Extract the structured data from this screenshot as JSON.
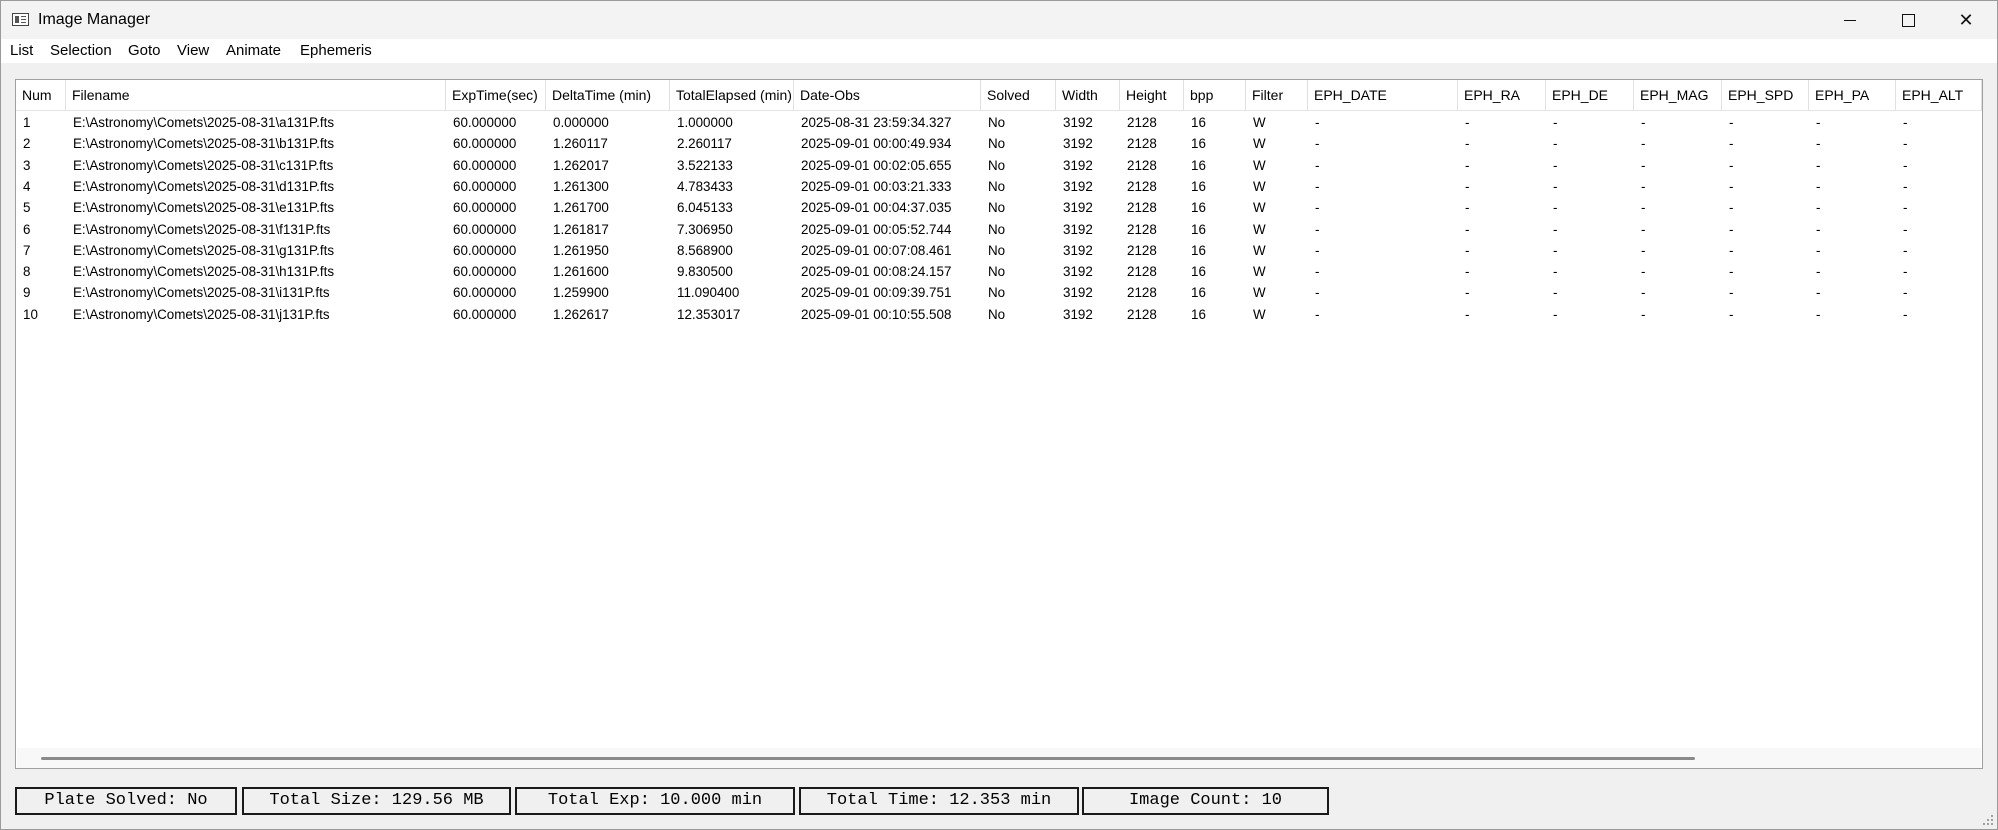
{
  "window": {
    "title": "Image Manager"
  },
  "menu": [
    {
      "label": "List",
      "name": "menu-list"
    },
    {
      "label": "Selection",
      "name": "menu-selection"
    },
    {
      "label": "Goto",
      "name": "menu-goto"
    },
    {
      "label": "View",
      "name": "menu-view"
    },
    {
      "label": "Animate",
      "name": "menu-animate"
    },
    {
      "label": "Ephemeris",
      "name": "menu-ephemeris"
    }
  ],
  "table": {
    "columns": [
      "Num",
      "Filename",
      "ExpTime(sec)",
      "DeltaTime (min)",
      "TotalElapsed (min)",
      "Date-Obs",
      "Solved",
      "Width",
      "Height",
      "bpp",
      "Filter",
      "EPH_DATE",
      "EPH_RA",
      "EPH_DE",
      "EPH_MAG",
      "EPH_SPD",
      "EPH_PA",
      "EPH_ALT"
    ],
    "rows": [
      [
        "1",
        "E:\\Astronomy\\Comets\\2025-08-31\\a131P.fts",
        "60.000000",
        "0.000000",
        "1.000000",
        "2025-08-31 23:59:34.327",
        "No",
        "3192",
        "2128",
        "16",
        "W",
        "-",
        "-",
        "-",
        "-",
        "-",
        "-",
        "-"
      ],
      [
        "2",
        "E:\\Astronomy\\Comets\\2025-08-31\\b131P.fts",
        "60.000000",
        "1.260117",
        "2.260117",
        "2025-09-01 00:00:49.934",
        "No",
        "3192",
        "2128",
        "16",
        "W",
        "-",
        "-",
        "-",
        "-",
        "-",
        "-",
        "-"
      ],
      [
        "3",
        "E:\\Astronomy\\Comets\\2025-08-31\\c131P.fts",
        "60.000000",
        "1.262017",
        "3.522133",
        "2025-09-01 00:02:05.655",
        "No",
        "3192",
        "2128",
        "16",
        "W",
        "-",
        "-",
        "-",
        "-",
        "-",
        "-",
        "-"
      ],
      [
        "4",
        "E:\\Astronomy\\Comets\\2025-08-31\\d131P.fts",
        "60.000000",
        "1.261300",
        "4.783433",
        "2025-09-01 00:03:21.333",
        "No",
        "3192",
        "2128",
        "16",
        "W",
        "-",
        "-",
        "-",
        "-",
        "-",
        "-",
        "-"
      ],
      [
        "5",
        "E:\\Astronomy\\Comets\\2025-08-31\\e131P.fts",
        "60.000000",
        "1.261700",
        "6.045133",
        "2025-09-01 00:04:37.035",
        "No",
        "3192",
        "2128",
        "16",
        "W",
        "-",
        "-",
        "-",
        "-",
        "-",
        "-",
        "-"
      ],
      [
        "6",
        "E:\\Astronomy\\Comets\\2025-08-31\\f131P.fts",
        "60.000000",
        "1.261817",
        "7.306950",
        "2025-09-01 00:05:52.744",
        "No",
        "3192",
        "2128",
        "16",
        "W",
        "-",
        "-",
        "-",
        "-",
        "-",
        "-",
        "-"
      ],
      [
        "7",
        "E:\\Astronomy\\Comets\\2025-08-31\\g131P.fts",
        "60.000000",
        "1.261950",
        "8.568900",
        "2025-09-01 00:07:08.461",
        "No",
        "3192",
        "2128",
        "16",
        "W",
        "-",
        "-",
        "-",
        "-",
        "-",
        "-",
        "-"
      ],
      [
        "8",
        "E:\\Astronomy\\Comets\\2025-08-31\\h131P.fts",
        "60.000000",
        "1.261600",
        "9.830500",
        "2025-09-01 00:08:24.157",
        "No",
        "3192",
        "2128",
        "16",
        "W",
        "-",
        "-",
        "-",
        "-",
        "-",
        "-",
        "-"
      ],
      [
        "9",
        "E:\\Astronomy\\Comets\\2025-08-31\\i131P.fts",
        "60.000000",
        "1.259900",
        "11.090400",
        "2025-09-01 00:09:39.751",
        "No",
        "3192",
        "2128",
        "16",
        "W",
        "-",
        "-",
        "-",
        "-",
        "-",
        "-",
        "-"
      ],
      [
        "10",
        "E:\\Astronomy\\Comets\\2025-08-31\\j131P.fts",
        "60.000000",
        "1.262617",
        "12.353017",
        "2025-09-01 00:10:55.508",
        "No",
        "3192",
        "2128",
        "16",
        "W",
        "-",
        "-",
        "-",
        "-",
        "-",
        "-",
        "-"
      ]
    ]
  },
  "status": {
    "plate_solved": "Plate Solved: No",
    "total_size": "Total Size: 129.56 MB",
    "total_exp": "Total Exp: 10.000 min",
    "total_time": "Total Time: 12.353 min",
    "image_count": "Image Count: 10"
  }
}
